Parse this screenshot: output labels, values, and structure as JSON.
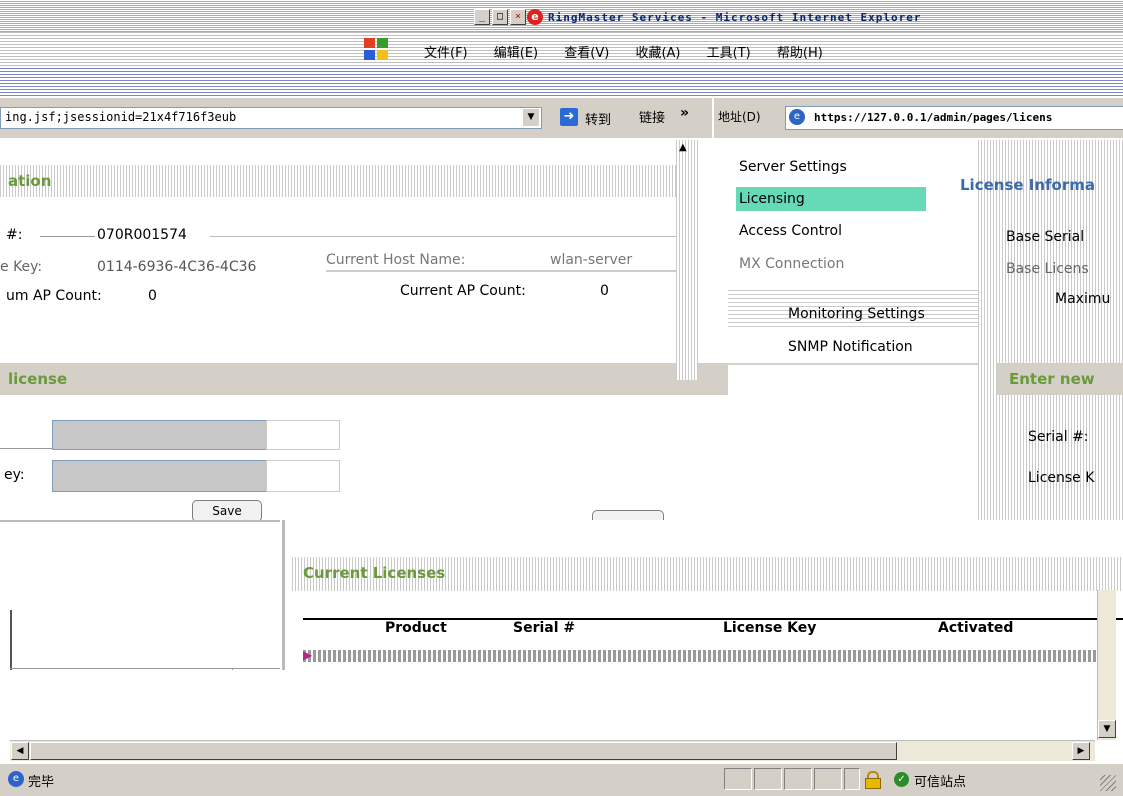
{
  "window": {
    "title": "RingMaster Services - Microsoft Internet Explorer",
    "controls": [
      "_",
      "□",
      "×"
    ]
  },
  "menu": {
    "items": [
      "文件(F)",
      "编辑(E)",
      "查看(V)",
      "收藏(A)",
      "工具(T)",
      "帮助(H)"
    ]
  },
  "address_left": {
    "url_fragment": "ing.jsf;jsessionid=21x4f716f3eub",
    "go_label": "转到",
    "links_label": "链接",
    "chevron": "»"
  },
  "address_right": {
    "label": "地址(D)",
    "url": "https://127.0.0.1/admin/pages/licens"
  },
  "left_pane": {
    "heading": "ation",
    "serial_label": "#:",
    "serial_value": "070R001574",
    "key_label": "e Key:",
    "key_value": "0114-6936-4C36-4C36",
    "host_label": "Current Host Name:",
    "host_value": "wlan-server",
    "max_ap_label": "um AP Count:",
    "max_ap_value": "0",
    "cur_ap_label": "Current AP Count:",
    "cur_ap_value": "0",
    "enter_heading": "license",
    "key_field_label": "ey:",
    "save_label": "Save"
  },
  "nav": {
    "items": [
      "Server Settings",
      "Licensing",
      "Access Control",
      "MX Connection"
    ],
    "sub_items": [
      "Monitoring Settings",
      "SNMP Notification"
    ],
    "selected_color": "#66d9b5"
  },
  "right_pane": {
    "heading": "License Informa",
    "base_serial_label": "Base Serial",
    "base_license_label": "Base Licens",
    "maximum_label": "Maximu",
    "enter_heading": "Enter new",
    "serial_label": "Serial #:",
    "license_key_label": "License K"
  },
  "current_licenses": {
    "heading": "Current Licenses",
    "columns": [
      "Product",
      "Serial #",
      "License Key",
      "Activated"
    ]
  },
  "status_bar": {
    "status_text": "完毕",
    "zone_text": "可信站点"
  },
  "colors": {
    "accent_green": "#6b9a3a",
    "nav_selected": "#66d9b5",
    "ie_blue": "#0a246a"
  }
}
